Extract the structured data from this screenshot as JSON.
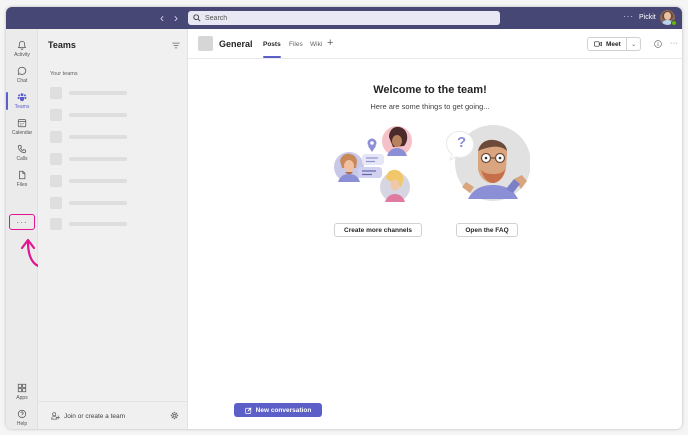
{
  "titlebar": {
    "back_icon": "chevron-left-icon",
    "forward_icon": "chevron-right-icon",
    "search_placeholder": "Search",
    "more_label": "···",
    "user_name": "Pickit",
    "colors": {
      "bar": "#464775",
      "presence": "#6bb700"
    }
  },
  "rail": {
    "items": [
      {
        "label": "Activity",
        "icon": "bell-icon"
      },
      {
        "label": "Chat",
        "icon": "chat-icon"
      },
      {
        "label": "Teams",
        "icon": "teams-icon",
        "active": true
      },
      {
        "label": "Calendar",
        "icon": "calendar-icon"
      },
      {
        "label": "Calls",
        "icon": "phone-icon"
      },
      {
        "label": "Files",
        "icon": "file-icon"
      }
    ],
    "more_label": "···",
    "bottom_items": [
      {
        "label": "Apps",
        "icon": "apps-icon"
      },
      {
        "label": "Help",
        "icon": "help-icon"
      }
    ],
    "highlight_color": "#e0158f"
  },
  "pane": {
    "title": "Teams",
    "section_label": "Your teams",
    "team_placeholders": 7,
    "join_label": "Join or create a team"
  },
  "channel": {
    "name": "General",
    "tabs": [
      "Posts",
      "Files",
      "Wiki"
    ],
    "active_tab": "Posts",
    "add_tab_label": "+",
    "meet_label": "Meet",
    "more_label": "···"
  },
  "welcome": {
    "title": "Welcome to the team!",
    "subtitle": "Here are some things to get going...",
    "create_channels_label": "Create more channels",
    "faq_label": "Open the FAQ",
    "new_conversation_label": "New conversation",
    "accent_color": "#5b5fc7"
  }
}
